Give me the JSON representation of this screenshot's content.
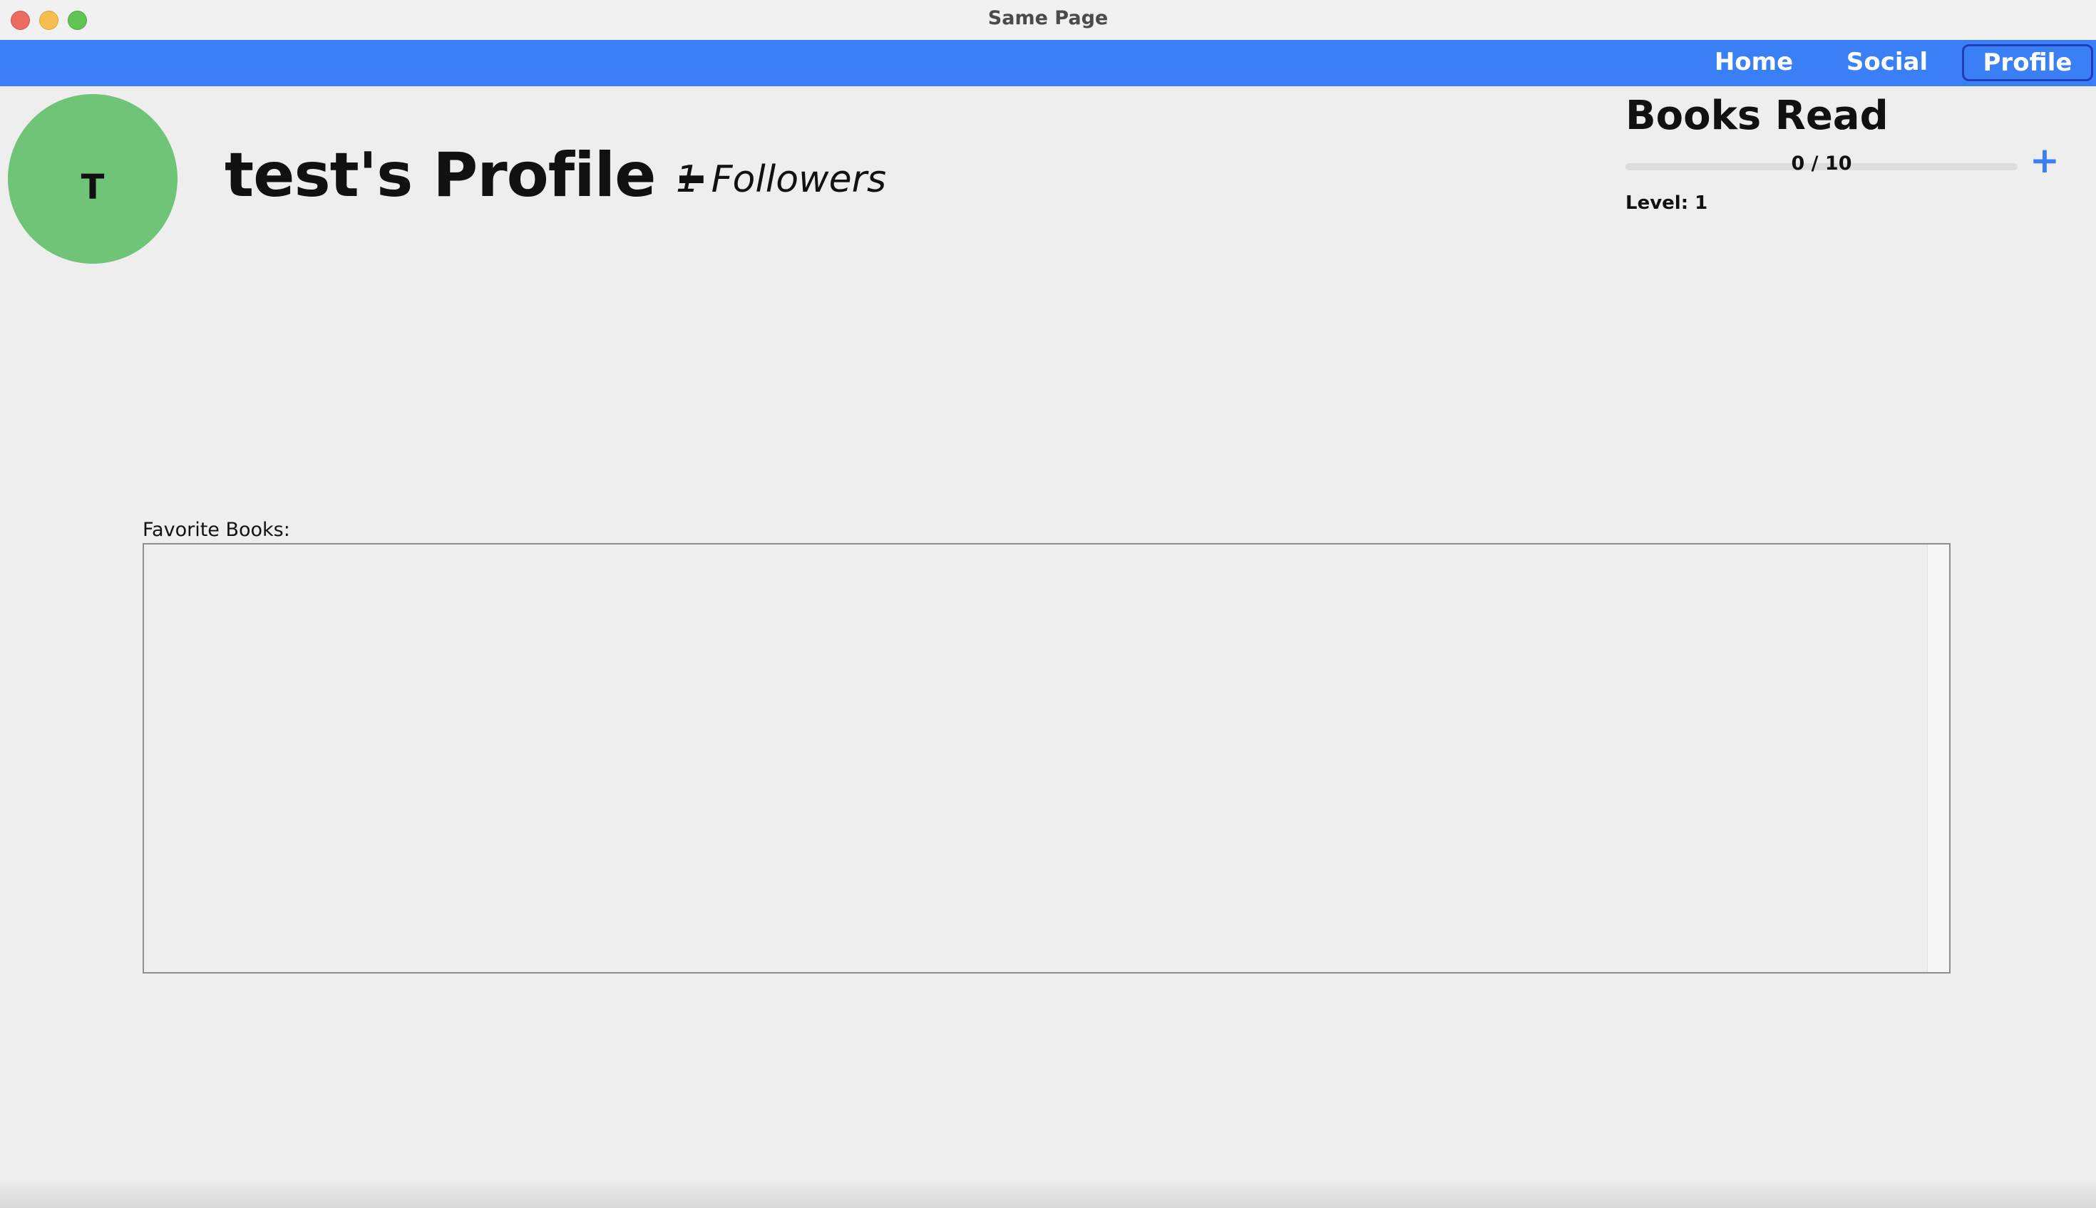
{
  "window": {
    "title": "Same Page"
  },
  "nav": {
    "home": "Home",
    "social": "Social",
    "profile": "Profile"
  },
  "profile": {
    "avatar_initial": "T",
    "title": "test's Profile –",
    "followers": "1 Followers"
  },
  "books_read": {
    "title": "Books Read",
    "progress_text": "0 / 10",
    "progress_fraction": 0,
    "add_icon": "plus-icon",
    "add_symbol": "+",
    "level": "Level: 1"
  },
  "favorites": {
    "label": "Favorite Books:",
    "items": []
  },
  "colors": {
    "accent": "#3a7ff6",
    "avatar": "#70c477",
    "background": "#eeeeee"
  }
}
